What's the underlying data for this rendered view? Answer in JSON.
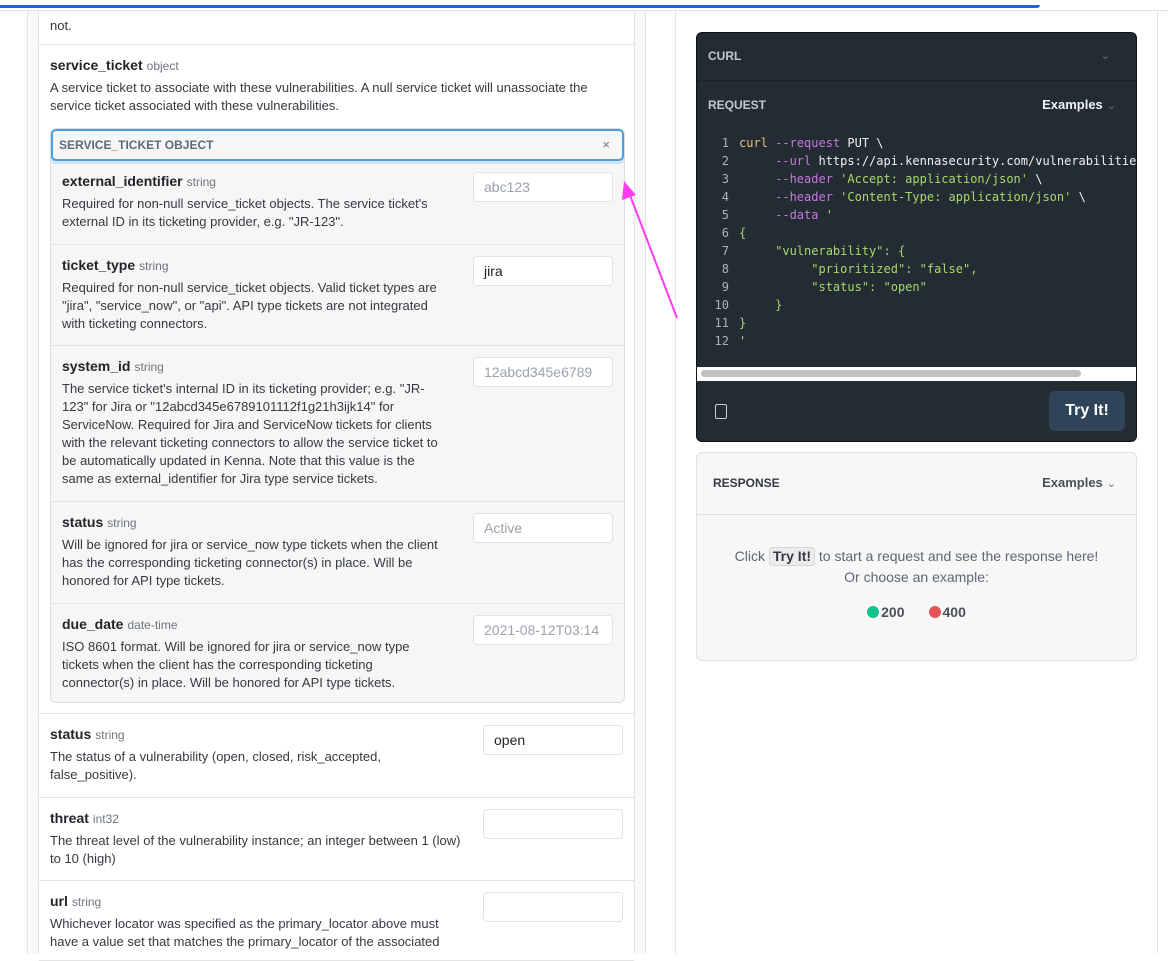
{
  "left": {
    "prev_desc_tail": "not.",
    "service_ticket": {
      "name": "service_ticket",
      "type": "object",
      "desc": "A service ticket to associate with these vulnerabilities. A null service ticket will unassociate the service ticket associated with these vulnerabilities.",
      "object_header": "SERVICE_TICKET OBJECT",
      "close_icon": "×",
      "fields": [
        {
          "name": "external_identifier",
          "type": "string",
          "desc": "Required for non-null service_ticket objects. The service ticket's external ID in its ticketing provider, e.g. \"JR-123\".",
          "placeholder": "abc123"
        },
        {
          "name": "ticket_type",
          "type": "string",
          "desc": "Required for non-null service_ticket objects. Valid ticket types are \"jira\", \"service_now\", or \"api\". API type tickets are not integrated with ticketing connectors.",
          "value": "jira"
        },
        {
          "name": "system_id",
          "type": "string",
          "desc": "The service ticket's internal ID in its ticketing provider; e.g. \"JR-123\" for Jira or \"12abcd345e6789101112f1g21h3ijk14\" for ServiceNow. Required for Jira and ServiceNow tickets for clients with the relevant ticketing connectors to allow the service ticket to be automatically updated in Kenna. Note that this value is the same as external_identifier for Jira type service tickets.",
          "placeholder": "12abcd345e6789"
        },
        {
          "name": "status",
          "type": "string",
          "desc": "Will be ignored for jira or service_now type tickets when the client has the corresponding ticketing connector(s) in place. Will be honored for API type tickets.",
          "placeholder": "Active"
        },
        {
          "name": "due_date",
          "type": "date-time",
          "desc": "ISO 8601 format. Will be ignored for jira or service_now type tickets when the client has the corresponding ticketing connector(s) in place. Will be honored for API type tickets.",
          "placeholder": "2021-08-12T03:14"
        }
      ]
    },
    "fields": [
      {
        "name": "status",
        "type": "string",
        "desc": "The status of a vulnerability (open, closed, risk_accepted, false_positive).",
        "value": "open"
      },
      {
        "name": "threat",
        "type": "int32",
        "desc": "The threat level of the vulnerability instance; an integer between 1 (low) to 10 (high)",
        "value": ""
      },
      {
        "name": "url",
        "type": "string",
        "desc": "Whichever locator was specified as the primary_locator above must have a value set that matches the primary_locator of the associated",
        "value": ""
      }
    ]
  },
  "curl": {
    "title": "CURL",
    "request_label": "REQUEST",
    "examples_label": "Examples",
    "code": [
      [
        [
          "k",
          "curl"
        ],
        [
          "p",
          " "
        ],
        [
          "f",
          "--request"
        ],
        [
          "p",
          " PUT \\"
        ]
      ],
      [
        [
          "p",
          "     "
        ],
        [
          "f",
          "--url"
        ],
        [
          "p",
          " https://api.kennasecurity.com/vulnerabilities"
        ]
      ],
      [
        [
          "p",
          "     "
        ],
        [
          "f",
          "--header"
        ],
        [
          "p",
          " "
        ],
        [
          "s",
          "'Accept: application/json'"
        ],
        [
          "p",
          " \\"
        ]
      ],
      [
        [
          "p",
          "     "
        ],
        [
          "f",
          "--header"
        ],
        [
          "p",
          " "
        ],
        [
          "s",
          "'Content-Type: application/json'"
        ],
        [
          "p",
          " \\"
        ]
      ],
      [
        [
          "p",
          "     "
        ],
        [
          "f",
          "--data"
        ],
        [
          "p",
          " "
        ],
        [
          "s",
          "'"
        ]
      ],
      [
        [
          "s",
          "{"
        ]
      ],
      [
        [
          "s",
          "     \"vulnerability\": {"
        ]
      ],
      [
        [
          "s",
          "          \"prioritized\": \"false\","
        ]
      ],
      [
        [
          "s",
          "          \"status\": \"open\""
        ]
      ],
      [
        [
          "s",
          "     }"
        ]
      ],
      [
        [
          "s",
          "}"
        ]
      ],
      [
        [
          "s",
          "'"
        ]
      ]
    ],
    "try_label": "Try It!"
  },
  "response": {
    "title": "RESPONSE",
    "examples_label": "Examples",
    "msg_pre": "Click",
    "msg_btn": "Try It!",
    "msg_post": "to start a request and see the response here!",
    "msg_line2": "Or choose an example:",
    "codes": [
      {
        "code": "200",
        "color": "#12c48b"
      },
      {
        "code": "400",
        "color": "#e5535b"
      }
    ]
  },
  "annotation_color": "#ff3df0"
}
